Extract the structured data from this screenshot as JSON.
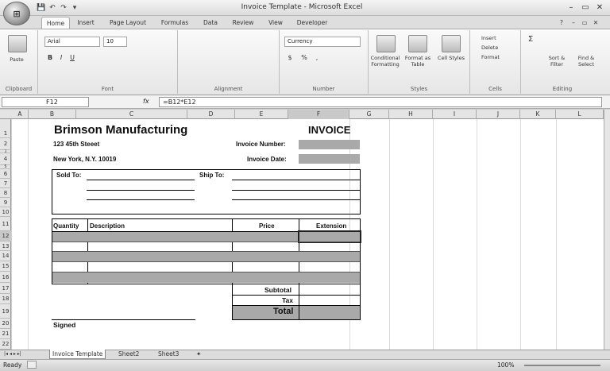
{
  "window": {
    "title": "Invoice Template - Microsoft Excel"
  },
  "qat": {
    "save": "💾",
    "undo": "↶",
    "redo": "↷",
    "more": "▾"
  },
  "office_button": {
    "label": "⊞"
  },
  "controls": {
    "minimize": "–",
    "restore": "▭",
    "close": "✕",
    "help": "?"
  },
  "tabs": [
    "Home",
    "Insert",
    "Page Layout",
    "Formulas",
    "Data",
    "Review",
    "View",
    "Developer"
  ],
  "ribbon": {
    "clipboard": {
      "label": "Clipboard",
      "paste": "Paste"
    },
    "font": {
      "label": "Font",
      "family": "Arial",
      "size": "10",
      "bold": "B",
      "italic": "I",
      "underline": "U"
    },
    "alignment": {
      "label": "Alignment"
    },
    "number": {
      "label": "Number",
      "format": "Currency",
      "currency": "$",
      "percent": "%",
      "comma": ","
    },
    "styles": {
      "label": "Styles",
      "conditional": "Conditional Formatting",
      "format_table": "Format as Table",
      "cell_styles": "Cell Styles"
    },
    "cells": {
      "label": "Cells",
      "insert": "Insert",
      "delete": "Delete",
      "format": "Format"
    },
    "editing": {
      "label": "Editing",
      "sum": "Σ",
      "sort": "Sort & Filter",
      "find": "Find & Select"
    }
  },
  "formula_bar": {
    "cell_ref": "F12",
    "fx": "fx",
    "formula": "=B12*E12"
  },
  "columns": [
    "A",
    "B",
    "C",
    "D",
    "E",
    "F",
    "G",
    "H",
    "I",
    "J",
    "K",
    "L"
  ],
  "rows": [
    "1",
    "2",
    "3",
    "4",
    "5",
    "6",
    "7",
    "8",
    "9",
    "10",
    "11",
    "12",
    "13",
    "14",
    "15",
    "16",
    "17",
    "18",
    "19",
    "20",
    "21",
    "22"
  ],
  "invoice": {
    "company": "Brimson Manufacturing",
    "doc_title": "INVOICE",
    "address1": "123 45th Steeet",
    "address2": "New York, N.Y. 10019",
    "invoice_number_label": "Invoice Number:",
    "invoice_date_label": "Invoice Date:",
    "sold_to_label": "Sold To:",
    "ship_to_label": "Ship To:",
    "headers": {
      "quantity": "Quantity",
      "description": "Description",
      "price": "Price",
      "extension": "Extension"
    },
    "subtotal_label": "Subtotal",
    "tax_label": "Tax",
    "total_label": "Total",
    "signed_label": "Signed"
  },
  "sheet_tabs": [
    "Invoice Template",
    "Sheet2",
    "Sheet3"
  ],
  "status": {
    "ready": "Ready",
    "zoom": "100%"
  }
}
